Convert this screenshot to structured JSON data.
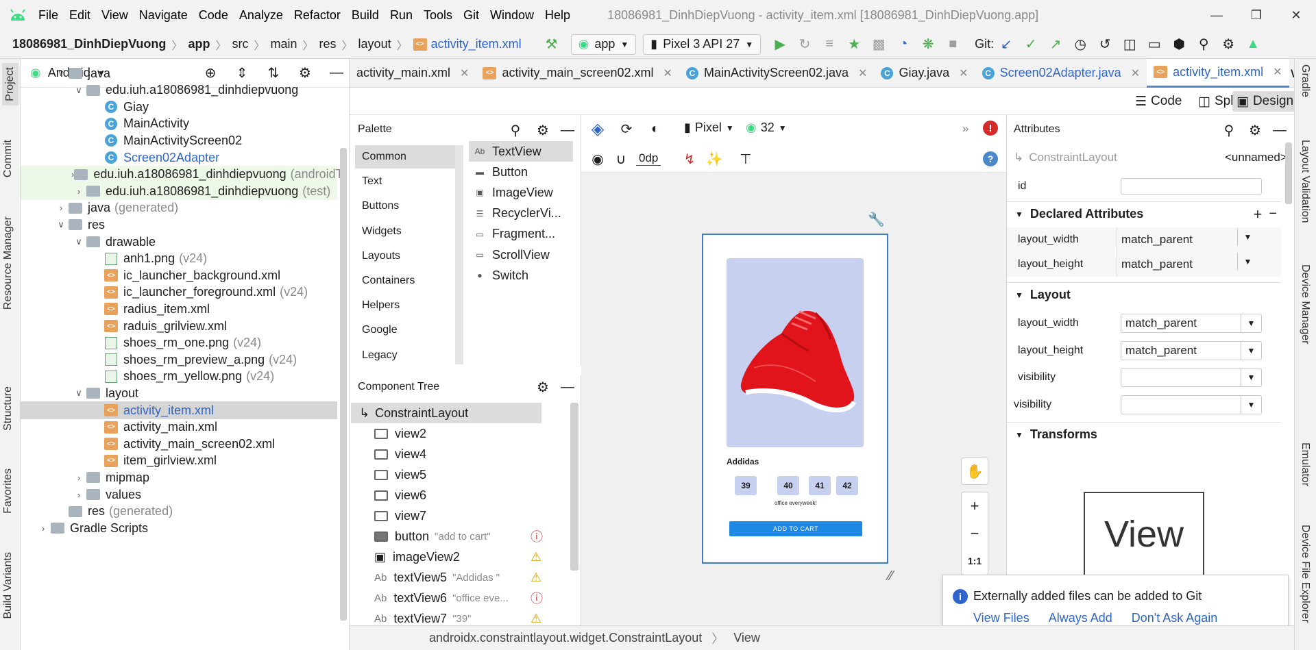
{
  "menu": {
    "items": [
      "File",
      "Edit",
      "View",
      "Navigate",
      "Code",
      "Analyze",
      "Refactor",
      "Build",
      "Run",
      "Tools",
      "Git",
      "Window",
      "Help"
    ],
    "window_title": "18086981_DinhDiepVuong - activity_item.xml [18086981_DinhDiepVuong.app]"
  },
  "breadcrumb": {
    "project": "18086981_DinhDiepVuong",
    "parts": [
      "app",
      "src",
      "main",
      "res",
      "layout"
    ],
    "file": "activity_item.xml"
  },
  "toolbar": {
    "run_config": "app",
    "device": "Pixel 3 API 27",
    "git_label": "Git:"
  },
  "left_tabs": [
    "Project",
    "Commit",
    "Resource Manager",
    "Structure",
    "Favorites",
    "Build Variants"
  ],
  "right_tabs": [
    "Gradle",
    "Layout Validation",
    "Device Manager",
    "Emulator",
    "Device File Explorer"
  ],
  "project": {
    "view_mode": "Android",
    "rows": [
      {
        "label": "java",
        "extra": "",
        "indent": 1,
        "arrow": "v",
        "icon": "folder",
        "style": ""
      },
      {
        "label": "edu.iuh.a18086981_dinhdiepvuong",
        "extra": "",
        "indent": 2,
        "arrow": "v",
        "icon": "folder",
        "style": ""
      },
      {
        "label": "Giay",
        "extra": "",
        "indent": 3,
        "arrow": "",
        "icon": "class",
        "style": ""
      },
      {
        "label": "MainActivity",
        "extra": "",
        "indent": 3,
        "arrow": "",
        "icon": "class",
        "style": ""
      },
      {
        "label": "MainActivityScreen02",
        "extra": "",
        "indent": 3,
        "arrow": "",
        "icon": "class",
        "style": ""
      },
      {
        "label": "Screen02Adapter",
        "extra": "",
        "indent": 3,
        "arrow": "",
        "icon": "class",
        "style": "blue"
      },
      {
        "label": "edu.iuh.a18086981_dinhdiepvuong",
        "extra": "(androidT",
        "indent": 2,
        "arrow": ">",
        "icon": "folder",
        "style": "green"
      },
      {
        "label": "edu.iuh.a18086981_dinhdiepvuong",
        "extra": "(test)",
        "indent": 2,
        "arrow": ">",
        "icon": "folder",
        "style": "green"
      },
      {
        "label": "java",
        "extra": "(generated)",
        "indent": 1,
        "arrow": ">",
        "icon": "folder",
        "style": ""
      },
      {
        "label": "res",
        "extra": "",
        "indent": 1,
        "arrow": "v",
        "icon": "folder",
        "style": ""
      },
      {
        "label": "drawable",
        "extra": "",
        "indent": 2,
        "arrow": "v",
        "icon": "folder",
        "style": ""
      },
      {
        "label": "anh1.png",
        "extra": "(v24)",
        "indent": 3,
        "arrow": "",
        "icon": "png",
        "style": ""
      },
      {
        "label": "ic_launcher_background.xml",
        "extra": "",
        "indent": 3,
        "arrow": "",
        "icon": "xml",
        "style": ""
      },
      {
        "label": "ic_launcher_foreground.xml",
        "extra": "(v24)",
        "indent": 3,
        "arrow": "",
        "icon": "xml",
        "style": ""
      },
      {
        "label": "radius_item.xml",
        "extra": "",
        "indent": 3,
        "arrow": "",
        "icon": "xml",
        "style": ""
      },
      {
        "label": "raduis_grilview.xml",
        "extra": "",
        "indent": 3,
        "arrow": "",
        "icon": "xml",
        "style": ""
      },
      {
        "label": "shoes_rm_one.png",
        "extra": "(v24)",
        "indent": 3,
        "arrow": "",
        "icon": "png",
        "style": ""
      },
      {
        "label": "shoes_rm_preview_a.png",
        "extra": "(v24)",
        "indent": 3,
        "arrow": "",
        "icon": "png",
        "style": ""
      },
      {
        "label": "shoes_rm_yellow.png",
        "extra": "(v24)",
        "indent": 3,
        "arrow": "",
        "icon": "png",
        "style": ""
      },
      {
        "label": "layout",
        "extra": "",
        "indent": 2,
        "arrow": "v",
        "icon": "folder",
        "style": ""
      },
      {
        "label": "activity_item.xml",
        "extra": "",
        "indent": 3,
        "arrow": "",
        "icon": "xml",
        "style": "selected"
      },
      {
        "label": "activity_main.xml",
        "extra": "",
        "indent": 3,
        "arrow": "",
        "icon": "xml",
        "style": ""
      },
      {
        "label": "activity_main_screen02.xml",
        "extra": "",
        "indent": 3,
        "arrow": "",
        "icon": "xml",
        "style": ""
      },
      {
        "label": "item_girlview.xml",
        "extra": "",
        "indent": 3,
        "arrow": "",
        "icon": "xml",
        "style": ""
      },
      {
        "label": "mipmap",
        "extra": "",
        "indent": 2,
        "arrow": ">",
        "icon": "folder",
        "style": ""
      },
      {
        "label": "values",
        "extra": "",
        "indent": 2,
        "arrow": ">",
        "icon": "folder",
        "style": ""
      },
      {
        "label": "res",
        "extra": "(generated)",
        "indent": 1,
        "arrow": "",
        "icon": "folder",
        "style": ""
      },
      {
        "label": "Gradle Scripts",
        "extra": "",
        "indent": 0,
        "arrow": ">",
        "icon": "folder",
        "style": ""
      }
    ]
  },
  "tabs": [
    {
      "label": "activity_main.xml",
      "icon": "none",
      "active": false
    },
    {
      "label": "activity_main_screen02.xml",
      "icon": "xml",
      "active": false
    },
    {
      "label": "MainActivityScreen02.java",
      "icon": "class",
      "active": false
    },
    {
      "label": "Giay.java",
      "icon": "class",
      "active": false
    },
    {
      "label": "Screen02Adapter.java",
      "icon": "class",
      "active": false
    },
    {
      "label": "activity_item.xml",
      "icon": "xml",
      "active": true
    }
  ],
  "modes": {
    "code": "Code",
    "split": "Split",
    "design": "Design"
  },
  "palette": {
    "title": "Palette",
    "categories": [
      "Common",
      "Text",
      "Buttons",
      "Widgets",
      "Layouts",
      "Containers",
      "Helpers",
      "Google",
      "Legacy"
    ],
    "items": [
      {
        "label": "TextView",
        "icon": "Ab"
      },
      {
        "label": "Button",
        "icon": "btn"
      },
      {
        "label": "ImageView",
        "icon": "img"
      },
      {
        "label": "RecyclerVi...",
        "icon": "list"
      },
      {
        "label": "Fragment...",
        "icon": "frag"
      },
      {
        "label": "ScrollView",
        "icon": "scroll"
      },
      {
        "label": "Switch",
        "icon": "switch"
      }
    ]
  },
  "component_tree": {
    "title": "Component Tree",
    "root": "ConstraintLayout",
    "rows": [
      {
        "label": "view2",
        "extra": "",
        "icon": "view",
        "status": ""
      },
      {
        "label": "view4",
        "extra": "",
        "icon": "view",
        "status": ""
      },
      {
        "label": "view5",
        "extra": "",
        "icon": "view",
        "status": ""
      },
      {
        "label": "view6",
        "extra": "",
        "icon": "view",
        "status": ""
      },
      {
        "label": "view7",
        "extra": "",
        "icon": "view",
        "status": ""
      },
      {
        "label": "button",
        "extra": "\"add to cart\"",
        "icon": "button",
        "status": "error"
      },
      {
        "label": "imageView2",
        "extra": "",
        "icon": "image",
        "status": "warning"
      },
      {
        "label": "textView5",
        "extra": "\"Addidas \"",
        "icon": "text",
        "status": "warning"
      },
      {
        "label": "textView6",
        "extra": "\"office eve...",
        "icon": "text",
        "status": "error"
      },
      {
        "label": "textView7",
        "extra": "\"39\"",
        "icon": "text",
        "status": "warning"
      }
    ]
  },
  "design_toolbar": {
    "device": "Pixel",
    "api": "32",
    "margin": "0dp"
  },
  "preview": {
    "product_name": "Addidas",
    "sizes": [
      "39",
      "40",
      "41",
      "42"
    ],
    "caption": "office everyweek!",
    "button": "ADD TO CART",
    "card_color": "#c8d0f0",
    "button_color": "#1e88e5"
  },
  "zoom": {
    "one_to_one": "1:1"
  },
  "attributes": {
    "title": "Attributes",
    "component": "ConstraintLayout",
    "name": "<unnamed>",
    "id_label": "id",
    "declared_title": "Declared Attributes",
    "declared": [
      {
        "label": "layout_width",
        "value": "match_parent"
      },
      {
        "label": "layout_height",
        "value": "match_parent"
      }
    ],
    "layout_title": "Layout",
    "layout": [
      {
        "label": "layout_width",
        "value": "match_parent"
      },
      {
        "label": "layout_height",
        "value": "match_parent"
      },
      {
        "label": "visibility",
        "value": ""
      },
      {
        "label": "visibility",
        "value": ""
      }
    ],
    "transforms_title": "Transforms",
    "transform_preview": "View"
  },
  "notification": {
    "message": "Externally added files can be added to Git",
    "actions": [
      "View Files",
      "Always Add",
      "Don't Ask Again"
    ]
  },
  "status": {
    "path": "androidx.constraintlayout.widget.ConstraintLayout",
    "leaf": "View"
  }
}
